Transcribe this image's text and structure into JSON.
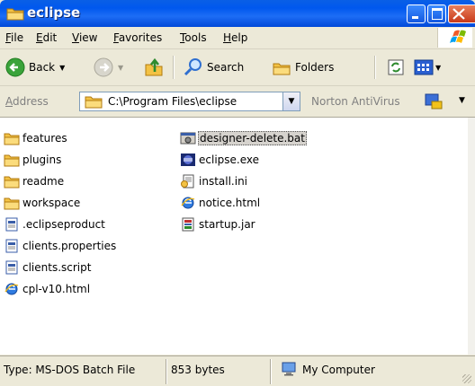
{
  "window": {
    "title": "eclipse"
  },
  "menu": {
    "items": [
      "File",
      "Edit",
      "View",
      "Favorites",
      "Tools",
      "Help"
    ]
  },
  "toolbar": {
    "back_label": "Back",
    "search_label": "Search",
    "folders_label": "Folders"
  },
  "address": {
    "label": "Address",
    "value": "C:\\Program Files\\eclipse",
    "norton_label": "Norton AntiVirus"
  },
  "files": {
    "col1": [
      {
        "name": "features",
        "icon": "folder-icon"
      },
      {
        "name": "plugins",
        "icon": "folder-icon"
      },
      {
        "name": "readme",
        "icon": "folder-icon"
      },
      {
        "name": "workspace",
        "icon": "folder-icon"
      },
      {
        "name": ".eclipseproduct",
        "icon": "file-icon"
      },
      {
        "name": "clients.properties",
        "icon": "file-icon"
      },
      {
        "name": "clients.script",
        "icon": "file-icon"
      },
      {
        "name": "cpl-v10.html",
        "icon": "ie-html-icon"
      }
    ],
    "col2": [
      {
        "name": "designer-delete.bat",
        "icon": "batch-file-icon",
        "selected": true
      },
      {
        "name": "eclipse.exe",
        "icon": "eclipse-app-icon"
      },
      {
        "name": "install.ini",
        "icon": "ini-file-icon"
      },
      {
        "name": "notice.html",
        "icon": "ie-html-icon"
      },
      {
        "name": "startup.jar",
        "icon": "jar-file-icon"
      }
    ]
  },
  "status": {
    "type": "Type: MS-DOS Batch File",
    "size": "853 bytes",
    "location": "My Computer"
  },
  "colors": {
    "titlebar": "#0058ee",
    "close_button": "#d9532c",
    "window_bg": "#ece9d8",
    "folder": "#f3c244"
  }
}
